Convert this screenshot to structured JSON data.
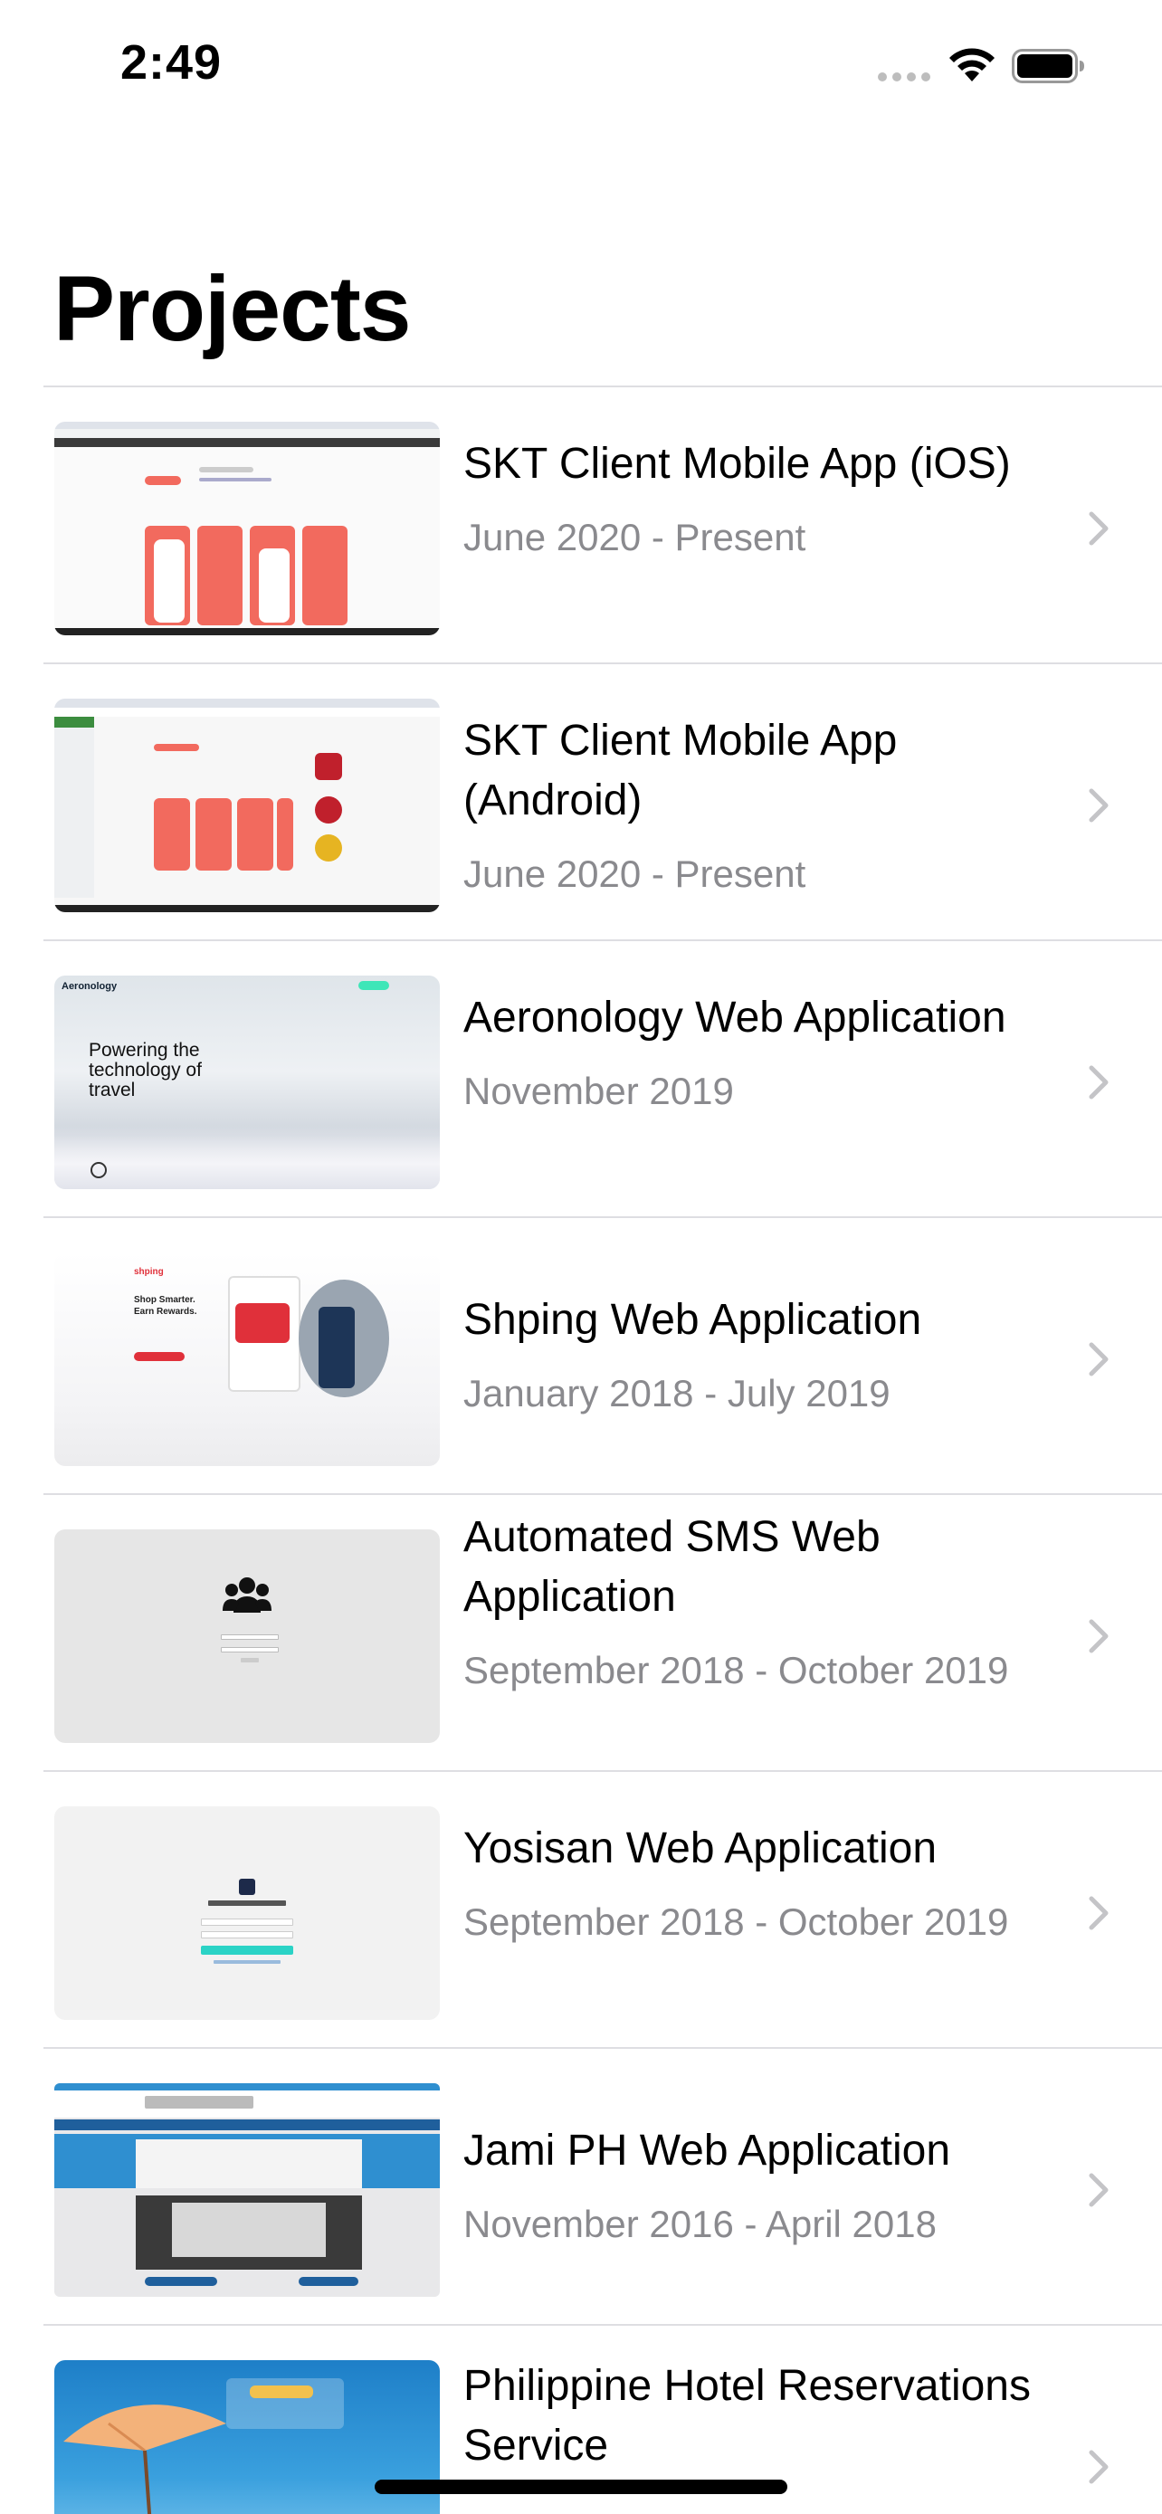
{
  "status_bar": {
    "time": "2:49"
  },
  "page_title": "Projects",
  "projects": [
    {
      "title": "SKT Client Mobile App (iOS)",
      "date": "June 2020 - Present"
    },
    {
      "title": "SKT Client Mobile App (Android)",
      "date": "June 2020 - Present"
    },
    {
      "title": "Aeronology Web Application",
      "date": "November 2019",
      "thumb_text": "Powering the technology of travel",
      "thumb_brand": "Aeronology"
    },
    {
      "title": "Shping Web Application",
      "date": "January 2018 - July 2019",
      "thumb_text": "Shop Smarter. Earn Rewards.",
      "thumb_brand": "shping"
    },
    {
      "title": "Automated SMS Web Application",
      "date": "September 2018 - October 2019"
    },
    {
      "title": "Yosisan Web Application",
      "date": "September 2018 - October 2019"
    },
    {
      "title": "Jami PH Web Application",
      "date": "November 2016 - April 2018"
    },
    {
      "title": "Philippine Hotel Reservations Service",
      "date": ""
    }
  ],
  "colors": {
    "separator": "#dedee2",
    "secondary_text": "#8a8a8e",
    "accent_coral": "#f26a5e",
    "accent_blue": "#2f8fd0"
  }
}
